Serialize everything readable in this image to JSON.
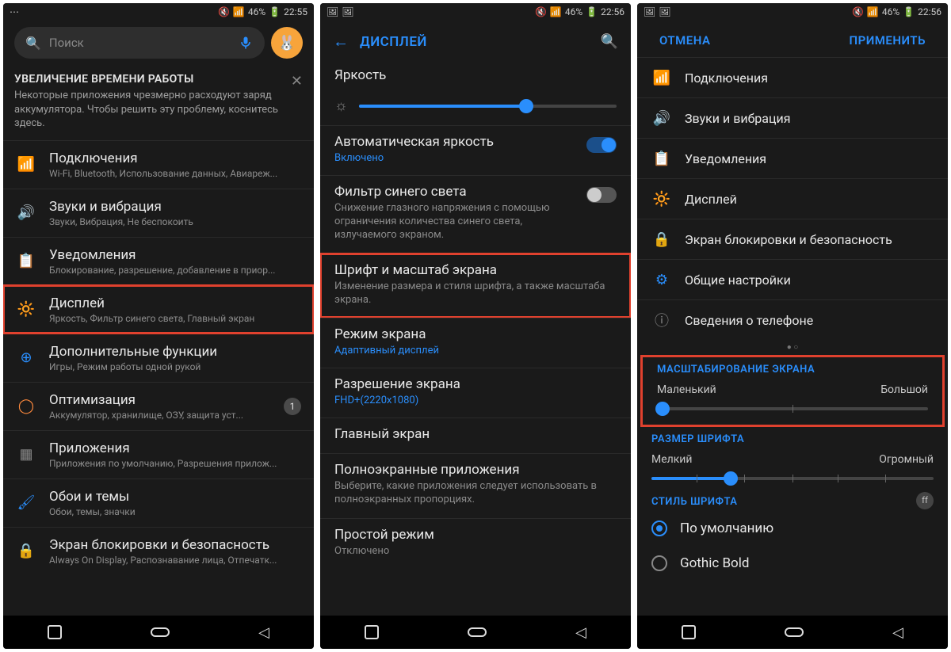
{
  "status": {
    "left_icons": [
      "⋯",
      "…"
    ],
    "mute": "🔇",
    "signal": "📶",
    "battery_pct": "46%",
    "battery": "🔋",
    "time1": "22:55",
    "time2": "22:56",
    "time3": "22:56",
    "screenshot_icon": "🖼"
  },
  "screen1": {
    "search_placeholder": "Поиск",
    "banner_title": "УВЕЛИЧЕНИЕ ВРЕМЕНИ РАБОТЫ",
    "banner_sub": "Некоторые приложения чрезмерно расходуют заряд аккумулятора. Чтобы решить эту проблему, коснитесь здесь.",
    "items": [
      {
        "icon": "📶",
        "color": "#2a8efc",
        "title": "Подключения",
        "sub": "Wi-Fi, Bluetooth, Использование данных, Авиареж..."
      },
      {
        "icon": "🔊",
        "color": "#2a8efc",
        "title": "Звуки и вибрация",
        "sub": "Звуки, Вибрация, Не беспокоить"
      },
      {
        "icon": "📋",
        "color": "#ff8a3d",
        "title": "Уведомления",
        "sub": "Блокирование, разрешение, добавление в приор..."
      },
      {
        "icon": "🔆",
        "color": "#8a8a8a",
        "title": "Дисплей",
        "sub": "Яркость, Фильтр синего света, Главный экран",
        "highlight": true
      },
      {
        "icon": "⊕",
        "color": "#2a8efc",
        "title": "Дополнительные функции",
        "sub": "Игры, Режим работы одной рукой"
      },
      {
        "icon": "◯",
        "color": "#ff8a3d",
        "title": "Оптимизация",
        "sub": "Аккумулятор, хранилище, ОЗУ, защита уст...",
        "badge": "1"
      },
      {
        "icon": "▦",
        "color": "#8a8a8a",
        "title": "Приложения",
        "sub": "Приложения по умолчанию, Разрешения прилож..."
      },
      {
        "icon": "🖌",
        "color": "#2a8efc",
        "title": "Обои и темы",
        "sub": "Обои, темы, значки"
      },
      {
        "icon": "🔒",
        "color": "#2a8efc",
        "title": "Экран блокировки и безопасность",
        "sub": "Always On Display, Распознавание лица, Отпечатк..."
      }
    ]
  },
  "screen2": {
    "header": "ДИСПЛЕЙ",
    "brightness_label": "Яркость",
    "brightness_pct": 65,
    "auto_brightness": {
      "title": "Автоматическая яркость",
      "status": "Включено",
      "on": true
    },
    "blue_filter": {
      "title": "Фильтр синего света",
      "sub": "Снижение глазного напряжения с помощью ограничения количества синего света, излучаемого экраном.",
      "on": false
    },
    "font_scale": {
      "title": "Шрифт и масштаб экрана",
      "sub": "Изменение размера и стиля шрифта, а также масштаба экрана.",
      "highlight": true
    },
    "screen_mode": {
      "title": "Режим экрана",
      "link": "Адаптивный дисплей"
    },
    "resolution": {
      "title": "Разрешение экрана",
      "link": "FHD+(2220x1080)"
    },
    "home": {
      "title": "Главный экран"
    },
    "fullscreen_apps": {
      "title": "Полноэкранные приложения",
      "sub": "Выберите, какие приложения следует использовать в полноэкранных пропорциях."
    },
    "simple_mode": {
      "title": "Простой режим",
      "status": "Отключено"
    }
  },
  "screen3": {
    "cancel": "ОТМЕНА",
    "apply": "ПРИМЕНИТЬ",
    "quick": [
      {
        "icon": "📶",
        "color": "#ff8a3d",
        "title": "Подключения"
      },
      {
        "icon": "🔊",
        "color": "#2a8efc",
        "title": "Звуки и вибрация"
      },
      {
        "icon": "📋",
        "color": "#ff8a3d",
        "title": "Уведомления"
      },
      {
        "icon": "🔆",
        "color": "#8a8a8a",
        "title": "Дисплей"
      },
      {
        "icon": "🔒",
        "color": "#2a8efc",
        "title": "Экран блокировки и безопасность"
      },
      {
        "icon": "⚙",
        "color": "#2a8efc",
        "title": "Общие настройки"
      },
      {
        "icon": "ⓘ",
        "color": "#8a8a8a",
        "title": "Сведения о телефоне"
      }
    ],
    "scale": {
      "header": "МАСШТАБИРОВАНИЕ ЭКРАНА",
      "small": "Маленький",
      "large": "Большой",
      "pct": 2
    },
    "fontsize": {
      "header": "РАЗМЕР ШРИФТА",
      "small": "Мелкий",
      "large": "Огромный",
      "pct": 28
    },
    "fontstyle": {
      "header": "СТИЛЬ ШРИФТА",
      "options": [
        "По умолчанию",
        "Gothic Bold"
      ],
      "selected": 0
    }
  }
}
